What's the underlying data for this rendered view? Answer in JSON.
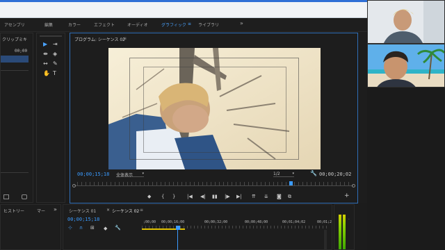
{
  "workspaces": {
    "tabs": [
      "アセンブリ",
      "編集",
      "カラー",
      "エフェクト",
      "オーディオ",
      "グラフィック",
      "ライブラリ"
    ],
    "active_index": 5,
    "menu_marker": "≡",
    "more": "»"
  },
  "left_panel": {
    "title": "クリップミキ",
    "timecode": "00;00",
    "more": "»"
  },
  "tools": {
    "icons": [
      "selection-tool-icon",
      "track-select-tool-icon",
      "ripple-edit-tool-icon",
      "razor-tool-icon",
      "slip-tool-icon",
      "pen-tool-icon",
      "hand-tool-icon",
      "type-tool-icon"
    ],
    "glyphs": [
      "▶",
      "⇥",
      "⇼",
      "◈",
      "↔",
      "✎",
      "✋",
      "T"
    ]
  },
  "program_monitor": {
    "title": "プログラム: シーケンス 02",
    "menu_marker": "≡",
    "more": "»",
    "current_timecode": "00;00;15;18",
    "zoom_label": "全体表示",
    "resolution_label": "1/2",
    "duration_timecode": "00;00;20;02",
    "playhead_fraction": 0.78
  },
  "bottom_left_panel": {
    "tabs": [
      "ヒストリー",
      "マー"
    ],
    "more": "»"
  },
  "timeline": {
    "tabs": [
      "シーケンス 01",
      "シーケンス 02"
    ],
    "close_glyph": "×",
    "menu_marker": "≡",
    "timecode": "00;00;15;18",
    "ruler": [
      ";00;00",
      "00;00;16;00",
      "00;00;32;00",
      "00;00;48;00",
      "00;01;04;02",
      "00;01;2"
    ]
  },
  "colors": {
    "accent": "#4aa3ff",
    "panel_bg": "#1d1d1d",
    "app_bg": "#1c1c1c",
    "timecode_blue": "#3b9bff"
  }
}
